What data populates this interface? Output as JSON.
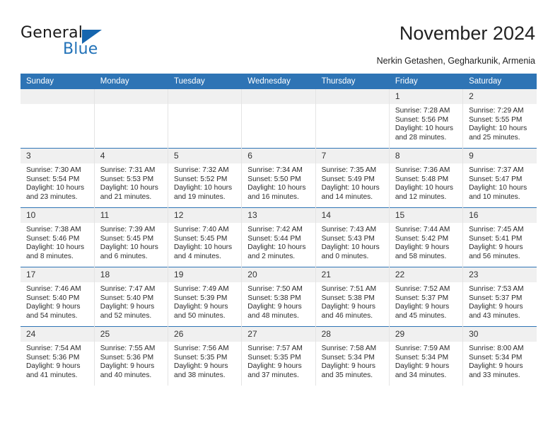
{
  "logo": {
    "word_one": "General",
    "word_two": "Blue",
    "triangle_color": "#1565ae",
    "blue_color": "#2272b8"
  },
  "header": {
    "title": "November 2024",
    "subtitle": "Nerkin Getashen, Gegharkunik, Armenia",
    "header_bg": "#2e74b5"
  },
  "weekdays": [
    "Sunday",
    "Monday",
    "Tuesday",
    "Wednesday",
    "Thursday",
    "Friday",
    "Saturday"
  ],
  "weeks": [
    [
      {
        "day": "",
        "empty": true
      },
      {
        "day": "",
        "empty": true
      },
      {
        "day": "",
        "empty": true
      },
      {
        "day": "",
        "empty": true
      },
      {
        "day": "",
        "empty": true
      },
      {
        "day": "1",
        "sunrise": "Sunrise: 7:28 AM",
        "sunset": "Sunset: 5:56 PM",
        "daylight_1": "Daylight: 10 hours",
        "daylight_2": "and 28 minutes."
      },
      {
        "day": "2",
        "sunrise": "Sunrise: 7:29 AM",
        "sunset": "Sunset: 5:55 PM",
        "daylight_1": "Daylight: 10 hours",
        "daylight_2": "and 25 minutes."
      }
    ],
    [
      {
        "day": "3",
        "sunrise": "Sunrise: 7:30 AM",
        "sunset": "Sunset: 5:54 PM",
        "daylight_1": "Daylight: 10 hours",
        "daylight_2": "and 23 minutes."
      },
      {
        "day": "4",
        "sunrise": "Sunrise: 7:31 AM",
        "sunset": "Sunset: 5:53 PM",
        "daylight_1": "Daylight: 10 hours",
        "daylight_2": "and 21 minutes."
      },
      {
        "day": "5",
        "sunrise": "Sunrise: 7:32 AM",
        "sunset": "Sunset: 5:52 PM",
        "daylight_1": "Daylight: 10 hours",
        "daylight_2": "and 19 minutes."
      },
      {
        "day": "6",
        "sunrise": "Sunrise: 7:34 AM",
        "sunset": "Sunset: 5:50 PM",
        "daylight_1": "Daylight: 10 hours",
        "daylight_2": "and 16 minutes."
      },
      {
        "day": "7",
        "sunrise": "Sunrise: 7:35 AM",
        "sunset": "Sunset: 5:49 PM",
        "daylight_1": "Daylight: 10 hours",
        "daylight_2": "and 14 minutes."
      },
      {
        "day": "8",
        "sunrise": "Sunrise: 7:36 AM",
        "sunset": "Sunset: 5:48 PM",
        "daylight_1": "Daylight: 10 hours",
        "daylight_2": "and 12 minutes."
      },
      {
        "day": "9",
        "sunrise": "Sunrise: 7:37 AM",
        "sunset": "Sunset: 5:47 PM",
        "daylight_1": "Daylight: 10 hours",
        "daylight_2": "and 10 minutes."
      }
    ],
    [
      {
        "day": "10",
        "sunrise": "Sunrise: 7:38 AM",
        "sunset": "Sunset: 5:46 PM",
        "daylight_1": "Daylight: 10 hours",
        "daylight_2": "and 8 minutes."
      },
      {
        "day": "11",
        "sunrise": "Sunrise: 7:39 AM",
        "sunset": "Sunset: 5:45 PM",
        "daylight_1": "Daylight: 10 hours",
        "daylight_2": "and 6 minutes."
      },
      {
        "day": "12",
        "sunrise": "Sunrise: 7:40 AM",
        "sunset": "Sunset: 5:45 PM",
        "daylight_1": "Daylight: 10 hours",
        "daylight_2": "and 4 minutes."
      },
      {
        "day": "13",
        "sunrise": "Sunrise: 7:42 AM",
        "sunset": "Sunset: 5:44 PM",
        "daylight_1": "Daylight: 10 hours",
        "daylight_2": "and 2 minutes."
      },
      {
        "day": "14",
        "sunrise": "Sunrise: 7:43 AM",
        "sunset": "Sunset: 5:43 PM",
        "daylight_1": "Daylight: 10 hours",
        "daylight_2": "and 0 minutes."
      },
      {
        "day": "15",
        "sunrise": "Sunrise: 7:44 AM",
        "sunset": "Sunset: 5:42 PM",
        "daylight_1": "Daylight: 9 hours",
        "daylight_2": "and 58 minutes."
      },
      {
        "day": "16",
        "sunrise": "Sunrise: 7:45 AM",
        "sunset": "Sunset: 5:41 PM",
        "daylight_1": "Daylight: 9 hours",
        "daylight_2": "and 56 minutes."
      }
    ],
    [
      {
        "day": "17",
        "sunrise": "Sunrise: 7:46 AM",
        "sunset": "Sunset: 5:40 PM",
        "daylight_1": "Daylight: 9 hours",
        "daylight_2": "and 54 minutes."
      },
      {
        "day": "18",
        "sunrise": "Sunrise: 7:47 AM",
        "sunset": "Sunset: 5:40 PM",
        "daylight_1": "Daylight: 9 hours",
        "daylight_2": "and 52 minutes."
      },
      {
        "day": "19",
        "sunrise": "Sunrise: 7:49 AM",
        "sunset": "Sunset: 5:39 PM",
        "daylight_1": "Daylight: 9 hours",
        "daylight_2": "and 50 minutes."
      },
      {
        "day": "20",
        "sunrise": "Sunrise: 7:50 AM",
        "sunset": "Sunset: 5:38 PM",
        "daylight_1": "Daylight: 9 hours",
        "daylight_2": "and 48 minutes."
      },
      {
        "day": "21",
        "sunrise": "Sunrise: 7:51 AM",
        "sunset": "Sunset: 5:38 PM",
        "daylight_1": "Daylight: 9 hours",
        "daylight_2": "and 46 minutes."
      },
      {
        "day": "22",
        "sunrise": "Sunrise: 7:52 AM",
        "sunset": "Sunset: 5:37 PM",
        "daylight_1": "Daylight: 9 hours",
        "daylight_2": "and 45 minutes."
      },
      {
        "day": "23",
        "sunrise": "Sunrise: 7:53 AM",
        "sunset": "Sunset: 5:37 PM",
        "daylight_1": "Daylight: 9 hours",
        "daylight_2": "and 43 minutes."
      }
    ],
    [
      {
        "day": "24",
        "sunrise": "Sunrise: 7:54 AM",
        "sunset": "Sunset: 5:36 PM",
        "daylight_1": "Daylight: 9 hours",
        "daylight_2": "and 41 minutes."
      },
      {
        "day": "25",
        "sunrise": "Sunrise: 7:55 AM",
        "sunset": "Sunset: 5:36 PM",
        "daylight_1": "Daylight: 9 hours",
        "daylight_2": "and 40 minutes."
      },
      {
        "day": "26",
        "sunrise": "Sunrise: 7:56 AM",
        "sunset": "Sunset: 5:35 PM",
        "daylight_1": "Daylight: 9 hours",
        "daylight_2": "and 38 minutes."
      },
      {
        "day": "27",
        "sunrise": "Sunrise: 7:57 AM",
        "sunset": "Sunset: 5:35 PM",
        "daylight_1": "Daylight: 9 hours",
        "daylight_2": "and 37 minutes."
      },
      {
        "day": "28",
        "sunrise": "Sunrise: 7:58 AM",
        "sunset": "Sunset: 5:34 PM",
        "daylight_1": "Daylight: 9 hours",
        "daylight_2": "and 35 minutes."
      },
      {
        "day": "29",
        "sunrise": "Sunrise: 7:59 AM",
        "sunset": "Sunset: 5:34 PM",
        "daylight_1": "Daylight: 9 hours",
        "daylight_2": "and 34 minutes."
      },
      {
        "day": "30",
        "sunrise": "Sunrise: 8:00 AM",
        "sunset": "Sunset: 5:34 PM",
        "daylight_1": "Daylight: 9 hours",
        "daylight_2": "and 33 minutes."
      }
    ]
  ]
}
